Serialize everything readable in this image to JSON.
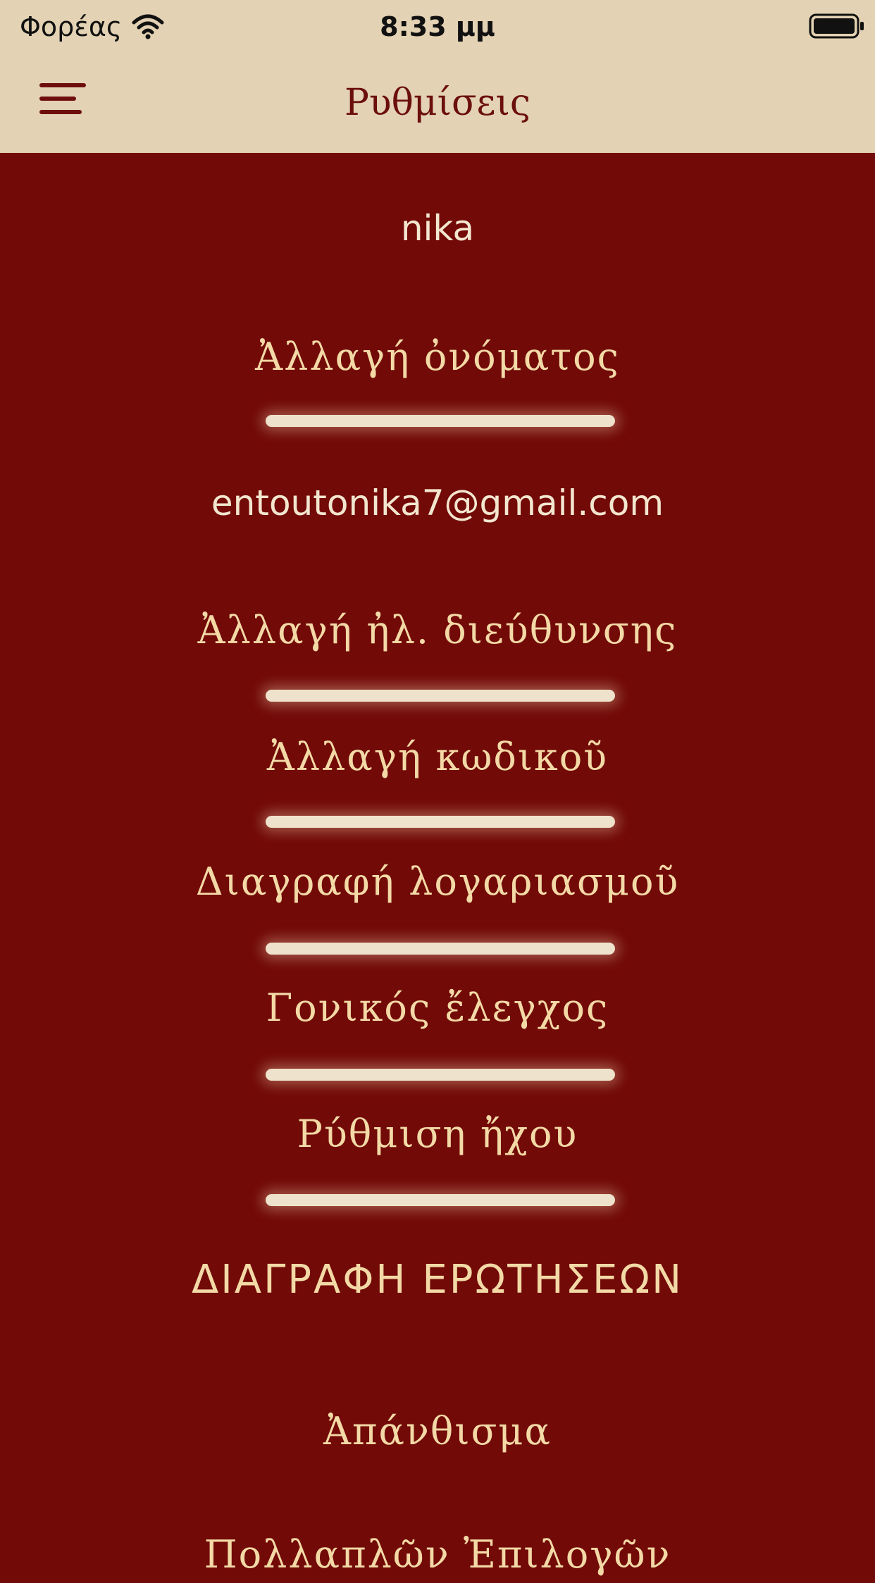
{
  "status_bar": {
    "carrier": "Φορέας",
    "time": "8:33 μμ",
    "wifi_icon": "wifi-icon",
    "battery_icon": "battery-full-icon"
  },
  "nav": {
    "title": "Ρυθμίσεις",
    "menu_icon": "hamburger-menu-icon"
  },
  "settings": {
    "username": "nika",
    "change_name": "Ἀλλαγή ὀνόματος",
    "email": "entoutonika7@gmail.com",
    "change_email": "Ἀλλαγή ἠλ. διεύθυνσης",
    "change_password": "Ἀλλαγή κωδικοῦ",
    "delete_account": "Διαγραφή λογαριασμοῦ",
    "parental_control": "Γονικός ἔλεγχος",
    "sound_settings": "Ρύθμιση ἤχου",
    "delete_questions": "ΔΙΑΓΡΑΦΗ ΕΡΩΤΗΣΕΩΝ",
    "anthology": "Ἀπάνθισμα",
    "multiple_choice": "Πολλαπλῶν Ἐπιλογῶν"
  },
  "colors": {
    "header_background": "#e3d2b3",
    "content_background": "#720a08",
    "title_color": "#6b0f0c",
    "action_text": "#f3d9a6",
    "info_text": "#f3e6cf",
    "divider": "#efe2cc"
  }
}
